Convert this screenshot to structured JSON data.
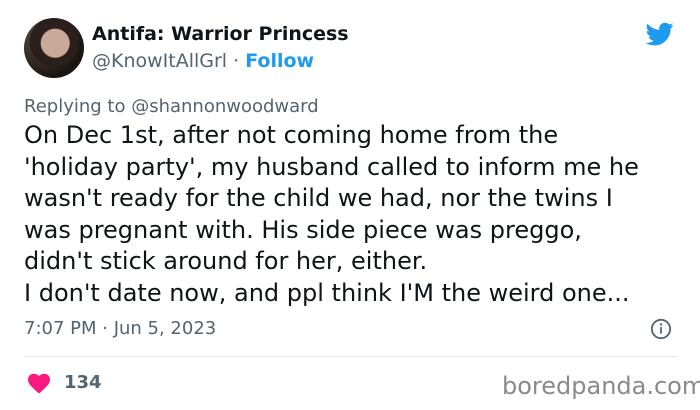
{
  "author": {
    "display_name": "Antifa: Warrior Princess",
    "handle": "@KnowItAllGrl",
    "separator": " · ",
    "follow_label": "Follow"
  },
  "tweet": {
    "replying_to": "Replying to @shannonwoodward",
    "text": "On Dec 1st, after not coming home from the\n'holiday party', my husband called to inform me he\nwasn't ready for the child we had, nor the twins I\nwas pregnant with. His side piece was preggo,\ndidn't stick around for her, either.\nI don't date now, and ppl think I'M the weird one...",
    "timestamp": "7:07 PM · Jun 5, 2023",
    "like_count": "134"
  },
  "watermark": "boredpanda.com",
  "icons": {
    "brand": "twitter-bird-icon",
    "info": "info-icon",
    "like": "heart-icon"
  },
  "colors": {
    "twitter_blue": "#1d9bf0",
    "heart_pink": "#f91880",
    "muted_text": "#536471"
  }
}
